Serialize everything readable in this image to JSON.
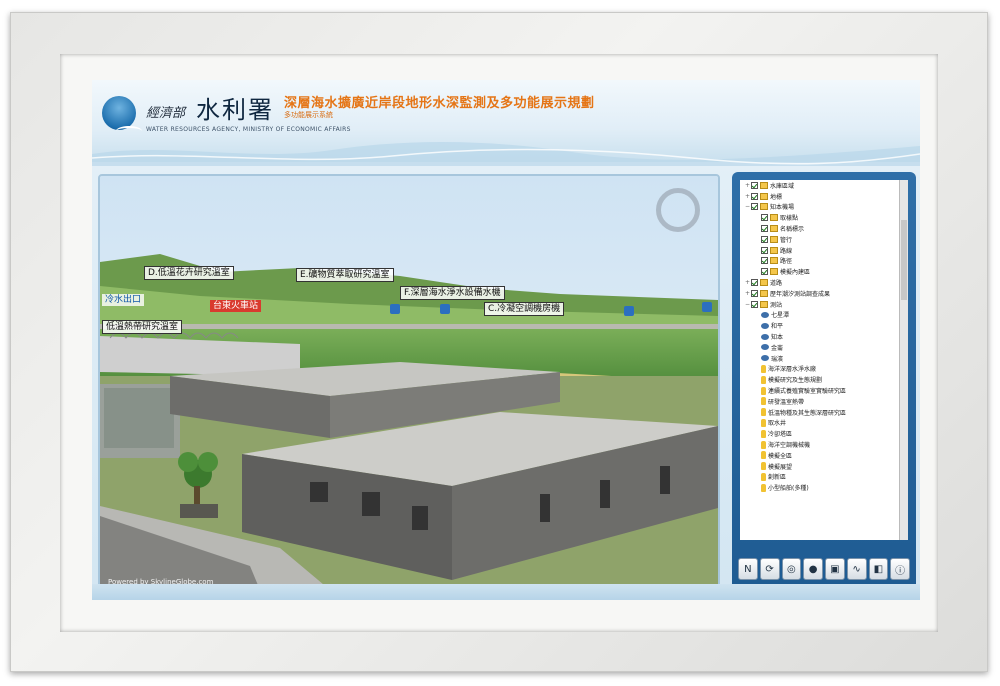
{
  "header": {
    "agency_small": "經濟部",
    "agency_large": "水利署",
    "agency_english": "WATER RESOURCES AGENCY, MINISTRY OF ECONOMIC AFFAIRS",
    "project_title": "深層海水擴廣近岸段地形水深監測及多功能展示規劃",
    "project_subtitle": "多功能展示系統"
  },
  "viewer": {
    "labels": {
      "d": "D.低溫花卉研究溫室",
      "e": "E.礦物質萃取研究溫室",
      "f": "F.深層海水淨水設備水機",
      "c": "C.冷凝空調機房機",
      "station": "台東火車站",
      "water": "冷水出口",
      "g": "低溫熱帶研究溫室"
    },
    "credit": "Powered by SkylineGlobe.com"
  },
  "layer_tree": {
    "items": [
      {
        "label": "水庫區域",
        "indent": 0,
        "icon": "folder",
        "checked": true,
        "expanded": false
      },
      {
        "label": "地標",
        "indent": 0,
        "icon": "folder",
        "checked": true,
        "expanded": false
      },
      {
        "label": "知本機場",
        "indent": 0,
        "icon": "folder",
        "checked": true,
        "expanded": true
      },
      {
        "label": "取樣點",
        "indent": 1,
        "icon": "folder",
        "checked": true
      },
      {
        "label": "名稱標示",
        "indent": 1,
        "icon": "folder",
        "checked": true
      },
      {
        "label": "管行",
        "indent": 1,
        "icon": "folder",
        "checked": true
      },
      {
        "label": "路線",
        "indent": 1,
        "icon": "folder",
        "checked": true
      },
      {
        "label": "路徑",
        "indent": 1,
        "icon": "folder",
        "checked": true
      },
      {
        "label": "模擬內建區",
        "indent": 1,
        "icon": "folder",
        "checked": true
      },
      {
        "label": "道路",
        "indent": 0,
        "icon": "folder",
        "checked": true,
        "expanded": false
      },
      {
        "label": "歷年潮汐測站調查成果",
        "indent": 0,
        "icon": "folder",
        "checked": true,
        "expanded": false
      },
      {
        "label": "測站",
        "indent": 0,
        "icon": "folder",
        "checked": true,
        "expanded": true
      },
      {
        "label": "七星潭",
        "indent": 1,
        "icon": "eye"
      },
      {
        "label": "和平",
        "indent": 1,
        "icon": "eye"
      },
      {
        "label": "知本",
        "indent": 1,
        "icon": "eye"
      },
      {
        "label": "金崙",
        "indent": 1,
        "icon": "eye"
      },
      {
        "label": "瑞濱",
        "indent": 1,
        "icon": "eye"
      },
      {
        "label": "海洋深層水淨水廠",
        "indent": 1,
        "icon": "bulb"
      },
      {
        "label": "模擬研究及生態規劃",
        "indent": 1,
        "icon": "bulb"
      },
      {
        "label": "連續式養殖實驗室實驗研究區",
        "indent": 1,
        "icon": "bulb"
      },
      {
        "label": "研發溫室熱帶",
        "indent": 1,
        "icon": "bulb"
      },
      {
        "label": "低溫物種及其生態深層研究區",
        "indent": 1,
        "icon": "bulb"
      },
      {
        "label": "取水井",
        "indent": 1,
        "icon": "bulb"
      },
      {
        "label": "冷卻塔區",
        "indent": 1,
        "icon": "bulb"
      },
      {
        "label": "海洋空調機械機",
        "indent": 1,
        "icon": "bulb"
      },
      {
        "label": "模擬全區",
        "indent": 1,
        "icon": "bulb"
      },
      {
        "label": "模擬展望",
        "indent": 1,
        "icon": "bulb"
      },
      {
        "label": "創新區",
        "indent": 1,
        "icon": "bulb"
      },
      {
        "label": "小型船舶(多種)",
        "indent": 1,
        "icon": "bulb"
      }
    ]
  },
  "toolbar": {
    "tools": [
      {
        "name": "north-compass",
        "glyph": "N"
      },
      {
        "name": "rotate",
        "glyph": "⟳"
      },
      {
        "name": "binoculars",
        "glyph": "◎"
      },
      {
        "name": "stop",
        "glyph": "●"
      },
      {
        "name": "camera",
        "glyph": "▣"
      },
      {
        "name": "measure",
        "glyph": "∿"
      },
      {
        "name": "layers",
        "glyph": "◧"
      },
      {
        "name": "info",
        "glyph": "ⓘ"
      }
    ]
  },
  "colors": {
    "title_orange": "#e57516",
    "panel_blue": "#1e5b92",
    "poi_red": "#d93a2e"
  }
}
